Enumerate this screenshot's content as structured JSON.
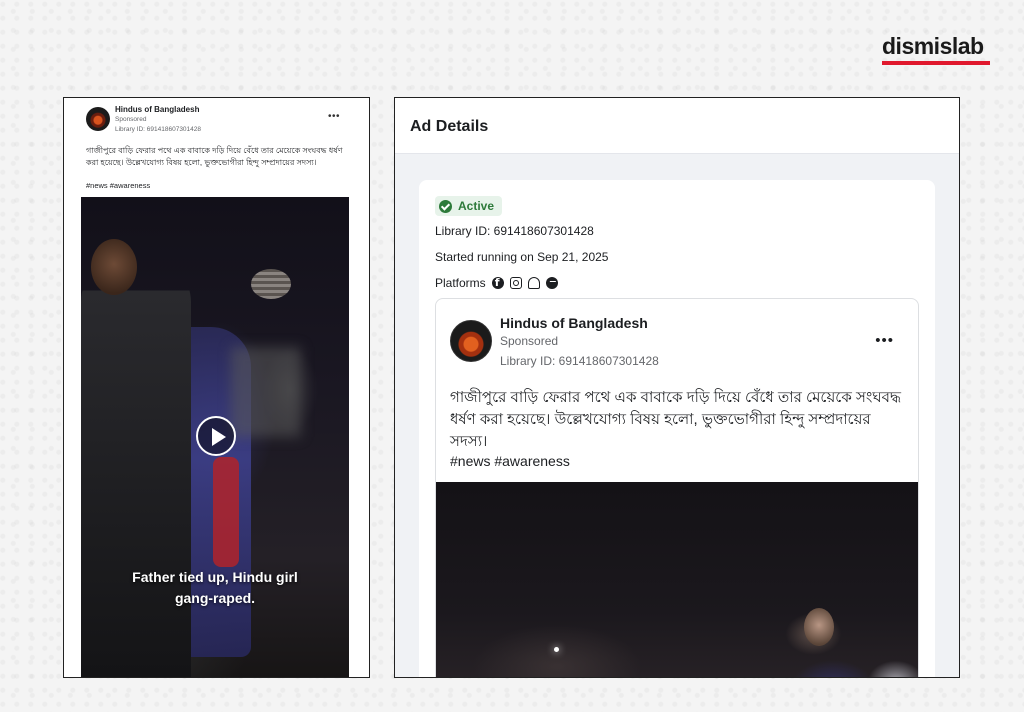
{
  "brand": {
    "logo_text": "dismislab",
    "accent": "#e0182d"
  },
  "left_ad": {
    "page_name": "Hindus of Bangladesh",
    "sponsored": "Sponsored",
    "library_id": "Library ID: 691418607301428",
    "more_label": "•••",
    "body_text": "গাজীপুরে বাড়ি ফেরার পথে এক বাবাকে দড়ি দিয়ে বেঁধে তার মেয়েকে সংঘবদ্ধ ধর্ষণ করা হয়েছে। উল্লেখযোগ্য বিষয় হলো, ভুক্তভোগীরা হিন্দু সম্প্রদায়ের সদস্য।",
    "hashtags": "#news #awareness",
    "video_caption_line1": "Father tied up, Hindu girl",
    "video_caption_line2": "gang-raped.",
    "play_icon": "play-icon"
  },
  "ad_details": {
    "title": "Ad Details",
    "status": "Active",
    "status_color": "#2d7a3a",
    "library_id": "Library ID: 691418607301428",
    "started_running": "Started running on Sep 21, 2025",
    "platforms_label": "Platforms",
    "platform_icons": [
      "facebook-icon",
      "instagram-icon",
      "audience-network-icon",
      "messenger-icon"
    ],
    "preview": {
      "page_name": "Hindus of Bangladesh",
      "sponsored": "Sponsored",
      "library_id": "Library ID: 691418607301428",
      "more_label": "•••",
      "body_text": "গাজীপুরে বাড়ি ফেরার পথে এক বাবাকে দড়ি দিয়ে বেঁধে তার মেয়েকে সংঘবদ্ধ ধর্ষণ করা হয়েছে। উল্লেখযোগ্য বিষয় হলো, ভুক্তভোগীরা হিন্দু সম্প্রদায়ের সদস্য।",
      "hashtags": "#news #awareness"
    }
  }
}
